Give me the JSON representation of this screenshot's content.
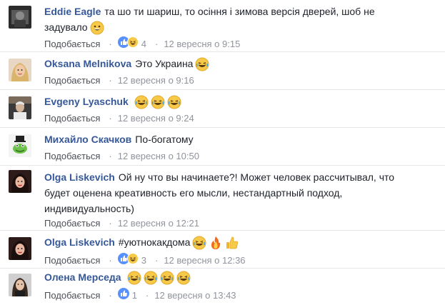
{
  "like_label": "Подобається",
  "comments": [
    {
      "author": "Eddie Eagle",
      "text_line1": "та шо ти шариш, то осіння і зимова версія дверей, шоб не",
      "text_line2": "задувало",
      "text_emoji": [
        "grin-icon"
      ],
      "reactions": [
        "like-icon",
        "haha-icon"
      ],
      "reaction_count": "4",
      "timestamp": "12 вересня о 9:15"
    },
    {
      "author": "Oksana Melnikova",
      "text": "Это Украина",
      "text_emoji": [
        "laughing-icon"
      ],
      "timestamp": "12 вересня о 9:16"
    },
    {
      "author": "Evgeny Lyaschuk",
      "text": "",
      "text_emoji": [
        "laughing-icon",
        "laughing-icon",
        "laughing-icon"
      ],
      "timestamp": "12 вересня о 9:24"
    },
    {
      "author": "Михайло Скачков",
      "text": "По-богатому",
      "timestamp": "12 вересня о 10:50"
    },
    {
      "author": "Olga Liskevich",
      "text_line1": "Ой ну что вы начинаете?! Может человек рассчитывал, что",
      "text_line2": "будет оценена креативность его мысли, нестандартный подход,",
      "text_line3": "индивидуальность)",
      "timestamp": "12 вересня о 12:21"
    },
    {
      "author": "Olga Liskevich",
      "text": "#уютнокакдома",
      "text_emoji": [
        "laughing-icon",
        "fire-icon",
        "thumbs-up-icon"
      ],
      "reactions": [
        "like-icon",
        "haha-icon"
      ],
      "reaction_count": "3",
      "timestamp": "12 вересня о 12:36"
    },
    {
      "author": "Олена Мерседа",
      "text": "",
      "text_emoji": [
        "laughing-icon",
        "laughing-icon",
        "laughing-icon",
        "laughing-icon"
      ],
      "reactions": [
        "like-icon"
      ],
      "reaction_count": "1",
      "timestamp": "12 вересня о 13:43"
    }
  ],
  "colors": {
    "author": "#365899",
    "text": "#1d2129",
    "meta": "#90949c",
    "like_blue": "#5890ff",
    "emoji_yellow": "#f7c948",
    "divider": "#e5e6e9"
  }
}
